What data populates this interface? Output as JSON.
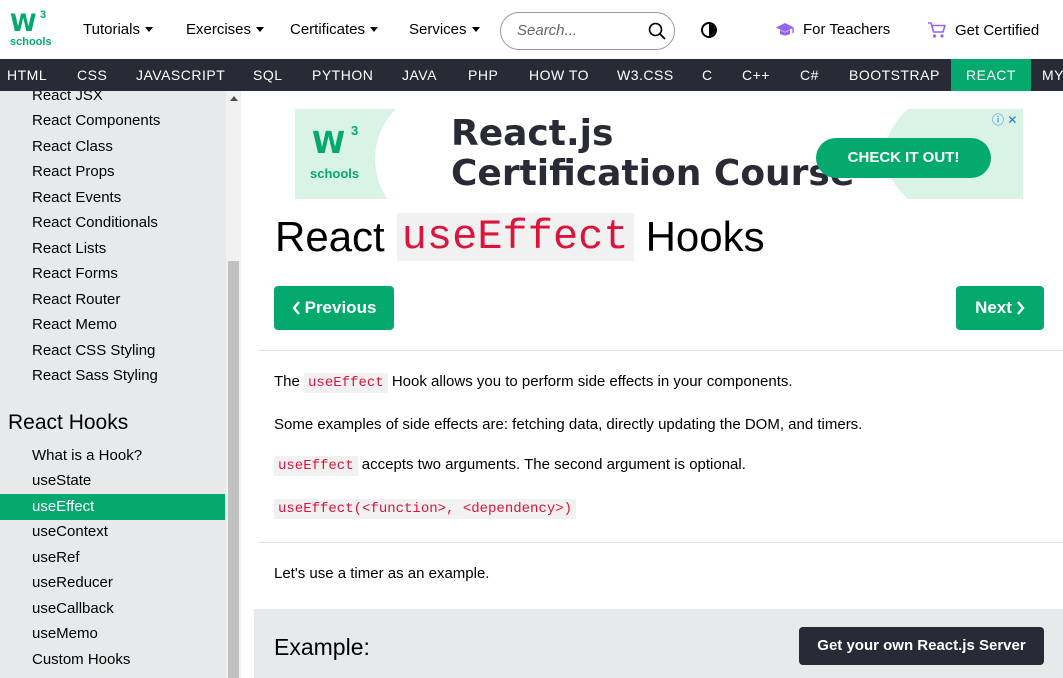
{
  "header": {
    "logo_mark": "W",
    "logo_sup": "3",
    "logo_sub": "schools",
    "nav": [
      {
        "label": "Tutorials"
      },
      {
        "label": "Exercises"
      },
      {
        "label": "Certificates"
      },
      {
        "label": "Services"
      }
    ],
    "search_placeholder": "Search...",
    "for_teachers": "For Teachers",
    "get_certified": "Get Certified"
  },
  "topics": [
    "HTML",
    "CSS",
    "JAVASCRIPT",
    "SQL",
    "PYTHON",
    "JAVA",
    "PHP",
    "HOW TO",
    "W3.CSS",
    "C",
    "C++",
    "C#",
    "BOOTSTRAP",
    "REACT",
    "MY"
  ],
  "active_topic": "REACT",
  "sidebar": {
    "links_top": [
      "React JSX",
      "React Components",
      "React Class",
      "React Props",
      "React Events",
      "React Conditionals",
      "React Lists",
      "React Forms",
      "React Router",
      "React Memo",
      "React CSS Styling",
      "React Sass Styling"
    ],
    "heading": "React Hooks",
    "links_hooks": [
      "What is a Hook?",
      "useState",
      "useEffect",
      "useContext",
      "useRef",
      "useReducer",
      "useCallback",
      "useMemo",
      "Custom Hooks"
    ],
    "active": "useEffect"
  },
  "ad": {
    "line1": "React.js",
    "line2": "Certification Course",
    "button": "CHECK IT OUT!",
    "logo_mark": "W",
    "logo_sup": "3",
    "logo_sub": "schools",
    "info": "ⓘ ✕"
  },
  "page": {
    "title_pre": "React",
    "title_code": "useEffect",
    "title_post": "Hooks",
    "prev": "Previous",
    "next": "Next",
    "p1_pre": "The",
    "p1_code": "useEffect",
    "p1_post": "Hook allows you to perform side effects in your components.",
    "p2": "Some examples of side effects are: fetching data, directly updating the DOM, and timers.",
    "p3_code": "useEffect",
    "p3_post": "accepts two arguments. The second argument is optional.",
    "p4_code": "useEffect(<function>, <dependency>)",
    "p5": "Let's use a timer as an example.",
    "example_label": "Example:",
    "server_button": "Get your own React.js Server"
  },
  "colors": {
    "brand_green": "#04AA6D",
    "dark_nav": "#282A35",
    "code_red": "#DC143C",
    "sidebar_bg": "#E7E9EB"
  }
}
